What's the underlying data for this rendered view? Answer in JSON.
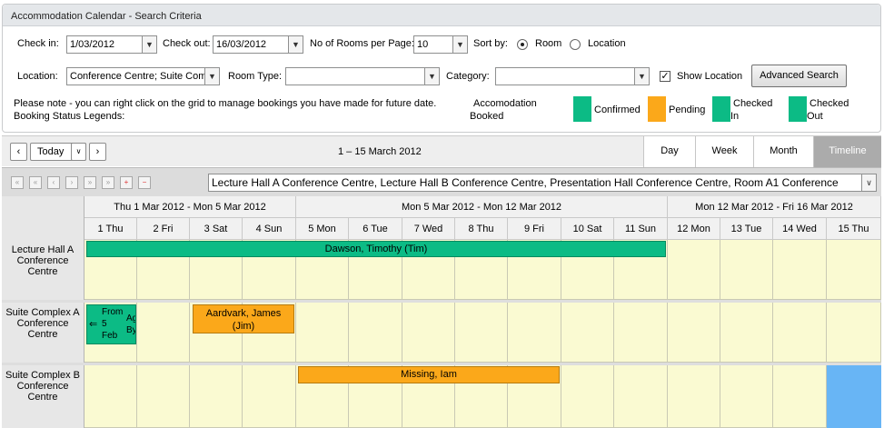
{
  "search": {
    "title": "Accommodation Calendar - Search Criteria",
    "check_in_label": "Check in:",
    "check_in_value": "1/03/2012",
    "check_out_label": "Check out:",
    "check_out_value": "16/03/2012",
    "rooms_per_page_label": "No of Rooms per Page:",
    "rooms_per_page_value": "10",
    "sort_by_label": "Sort by:",
    "sort_room_label": "Room",
    "sort_location_label": "Location",
    "location_label": "Location:",
    "location_value": "Conference Centre; Suite Com",
    "room_type_label": "Room Type:",
    "room_type_value": "",
    "category_label": "Category:",
    "category_value": "",
    "show_location_label": "Show Location",
    "show_location_checked": true,
    "advanced_search_label": "Advanced Search",
    "note_line1": "Please note - you can right click on the grid to manage bookings you have made for future date.",
    "note_line2": "Booking Status Legends:",
    "legend_booked_line1": "Accomodation",
    "legend_booked_line2": "Booked",
    "legends": [
      {
        "label1": "Confirmed",
        "label2": "",
        "color": "#0cbb85"
      },
      {
        "label1": "Pending",
        "label2": "",
        "color": "#fba81a"
      },
      {
        "label1": "Checked",
        "label2": "In",
        "color": "#0cbb85"
      },
      {
        "label1": "Checked",
        "label2": "Out",
        "color": "#0cbb85"
      }
    ]
  },
  "toolbar": {
    "today_label": "Today",
    "date_range": "1 – 15 March 2012",
    "views": [
      "Day",
      "Week",
      "Month",
      "Timeline"
    ],
    "active_view": "Timeline",
    "room_filter_value": "Lecture Hall A Conference Centre, Lecture Hall B Conference Centre, Presentation Hall Conference Centre, Room A1 Conference"
  },
  "grid": {
    "weeks": [
      "Thu 1 Mar 2012 - Mon 5 Mar 2012",
      "Mon 5 Mar 2012 - Mon 12 Mar 2012",
      "Mon 12 Mar 2012 - Fri 16 Mar 2012"
    ],
    "days": [
      "1 Thu",
      "2 Fri",
      "3 Sat",
      "4 Sun",
      "5 Mon",
      "6 Tue",
      "7 Wed",
      "8 Thu",
      "9 Fri",
      "10 Sat",
      "11 Sun",
      "12 Mon",
      "13 Tue",
      "14 Wed",
      "15 Thu"
    ],
    "rooms": [
      {
        "line1": "Lecture Hall A",
        "line2": "Conference",
        "line3": "Centre"
      },
      {
        "line1": "Suite Complex A",
        "line2": "Conference",
        "line3": "Centre"
      },
      {
        "line1": "Suite Complex B",
        "line2": "Conference",
        "line3": "Centre"
      }
    ],
    "events": {
      "dawson": "Dawson, Timothy (Tim)",
      "from_feb_1": "From",
      "from_feb_2": "5",
      "from_feb_3": "Feb",
      "from_feb_side1": "Ag",
      "from_feb_side2": "By",
      "aardvark_1": "Aardvark, James",
      "aardvark_2": "(Jim)",
      "missing": "Missing, Iam"
    },
    "colors": {
      "confirmed": "#0cbb85",
      "pending": "#fba81a",
      "selected": "#68b5f5",
      "cell": "#fafad2"
    }
  }
}
